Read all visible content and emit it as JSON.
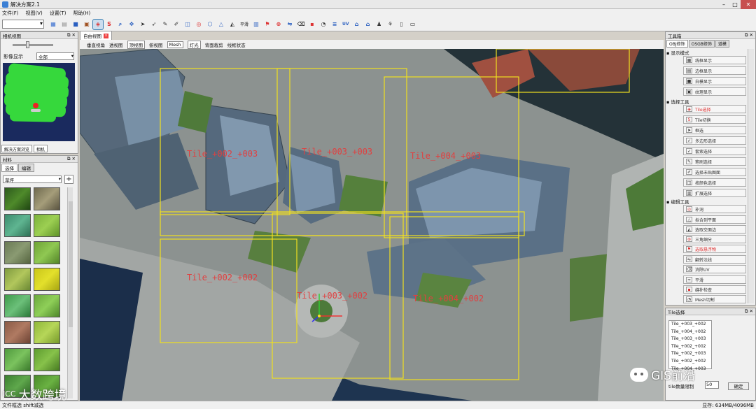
{
  "window": {
    "title": "解决方案2.1"
  },
  "menu": [
    "文件(F)",
    "视图(V)",
    "设置(T)",
    "帮助(H)"
  ],
  "toolbar": {
    "labels": [
      "平滑",
      "UV"
    ]
  },
  "camera_panel": {
    "title": "相机视图",
    "image_display_label": "影像显示",
    "image_display_value": "全部",
    "tabs": [
      "解决方案浏览",
      "相机"
    ]
  },
  "material_panel": {
    "title": "材料",
    "tabs": [
      "选择",
      "编辑"
    ],
    "category": "草坪"
  },
  "doc": {
    "tab": "自由视图",
    "view_buttons": [
      "垂直视角",
      "透视图",
      "顶视图",
      "俯视图",
      "Mesh",
      "灯光",
      "背面裁剪",
      "线框状态"
    ],
    "active_view": 2
  },
  "viewport": {
    "tiles": [
      {
        "label": "Tile_+002_+003",
        "color": "#e04040"
      },
      {
        "label": "Tile_+003_+003",
        "color": "#e04040"
      },
      {
        "label": "Tile_+004_+003",
        "color": "#e04040"
      },
      {
        "label": "Tile_+002_+002",
        "color": "#e04040"
      },
      {
        "label": "Tile_+003_+002",
        "color": "#e04040"
      },
      {
        "label": "Tile_+004_+002",
        "color": "#e04040"
      }
    ]
  },
  "toolbox": {
    "title": "工具箱",
    "tabs": [
      "OBJ修饰",
      "OSGB修饰",
      "道模"
    ],
    "groups": [
      {
        "name": "显示模式",
        "items": [
          "线框显示",
          "边框显示",
          "白模显示",
          "纹理显示"
        ]
      },
      {
        "name": "选择工具",
        "items": [
          "Tile选择",
          "Tile切换",
          "框选",
          "多边形选择",
          "套索选择",
          "笔刷选择",
          "选择未贴图面",
          "按颜色选择",
          "扩展选择"
        ]
      },
      {
        "name": "编辑工具",
        "items": [
          "补洞",
          "拟合到平面",
          "选取交面边",
          "三角细分",
          "选取悬浮物",
          "翻转法线",
          "消除UV",
          "平滑",
          "缝补检查",
          "Mesh切割"
        ]
      }
    ]
  },
  "tile_panel": {
    "title": "Tile选择",
    "list": [
      "Tile_+003_+002",
      "Tile_+004_+002",
      "Tile_+003_+003",
      "Tile_+002_+002",
      "Tile_+002_+003",
      "Tile_+002_+002",
      "Tile_+004_+003"
    ],
    "count_label": "tile数量限制",
    "count_value": "50",
    "ok_label": "确定"
  },
  "watermark": {
    "wechat": "GIS前沿",
    "brand_small": "ICC",
    "brand": "大数跨境"
  },
  "status": {
    "left": "文件框选 shift减选",
    "right": "显存: 634MB/4096MB"
  },
  "colors": {
    "tile_frame": "#f0e020",
    "tile_text": "#e04040",
    "viewport_bg": "#1e3450"
  }
}
